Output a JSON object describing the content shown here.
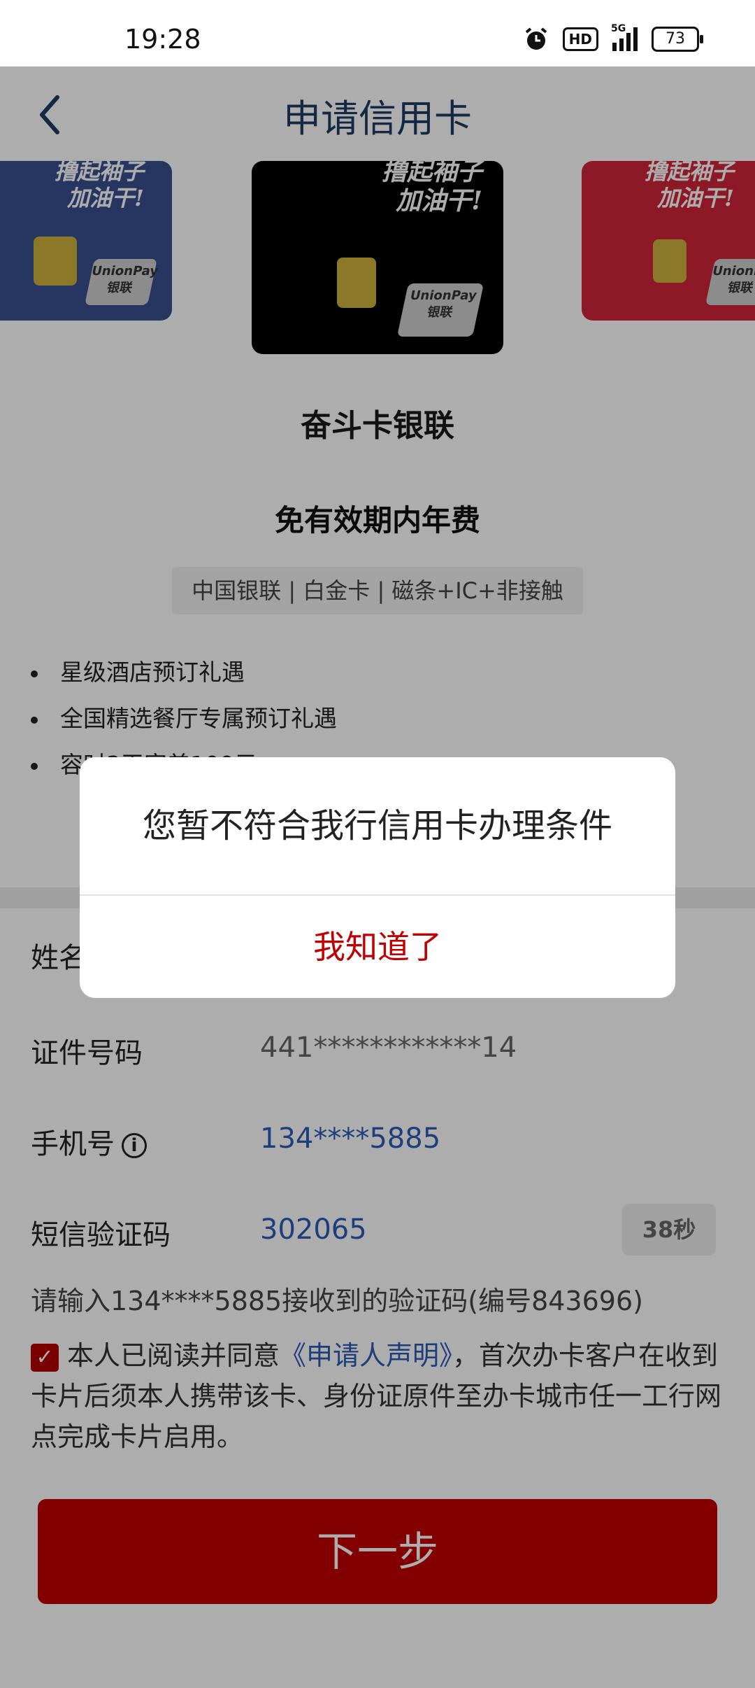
{
  "status_bar": {
    "time": "19:28",
    "hd": "HD",
    "network": "5G",
    "battery": "73"
  },
  "header": {
    "title": "申请信用卡"
  },
  "cards": {
    "slogan_line1": "撸起袖子",
    "slogan_line2": "加油干!",
    "unionpay_en": "UnionPay",
    "unionpay_cn": "银联",
    "colors": {
      "left": "#3a4f8f",
      "center": "#000000",
      "right": "#d0263a"
    }
  },
  "card_info": {
    "name": "奋斗卡银联",
    "annual_fee": "免有效期内年费",
    "attributes": "中国银联 | 白金卡 | 磁条+IC+非接触",
    "benefits": [
      "星级酒店预订礼遇",
      "全国精选餐厅专属预订礼遇",
      "容时3天容差100元"
    ]
  },
  "form": {
    "name_label": "姓名",
    "id_label": "证件号码",
    "id_value": "441************14",
    "phone_label": "手机号",
    "info_glyph": "i",
    "phone_value": "134****5885",
    "sms_label": "短信验证码",
    "sms_value": "302065",
    "countdown": "38秒"
  },
  "helper_text": "请输入134****5885接收到的验证码(编号843696)",
  "agreement": {
    "prefix": "本人已阅读并同意",
    "link": "《申请人声明》",
    "suffix": "，首次办卡客户在收到卡片后须本人携带该卡、身份证原件至办卡城市任一工行网点完成卡片启用。"
  },
  "next_button": "下一步",
  "dialog": {
    "message": "您暂不符合我行信用卡办理条件",
    "confirm": "我知道了"
  }
}
